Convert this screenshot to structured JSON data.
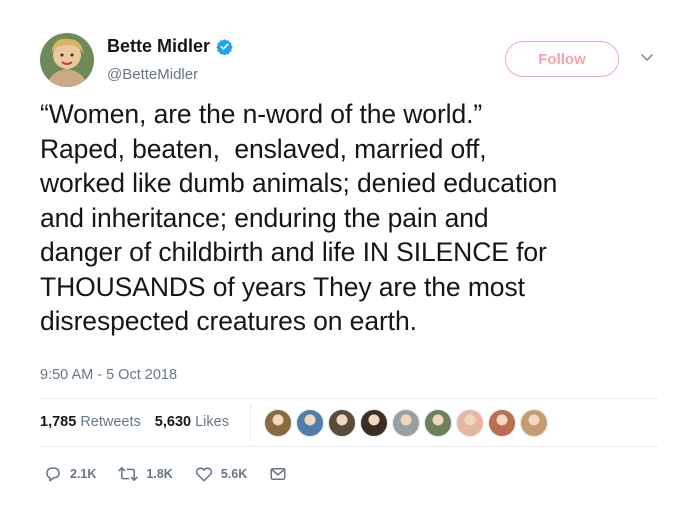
{
  "author": {
    "name": "Bette Midler",
    "handle": "@BetteMidler",
    "verified": true
  },
  "follow_label": "Follow",
  "tweet_lines": [
    "“Women, are the n-word of the world.”",
    "Raped, beaten,  enslaved, married off,",
    "worked like dumb animals; denied education",
    "and inheritance; enduring the pain and",
    "danger of childbirth and life IN SILENCE for",
    "THOUSANDS of years They are the most",
    "disrespected creatures on earth."
  ],
  "timestamp": "9:50 AM - 5 Oct 2018",
  "stats": {
    "retweets_count": "1,785",
    "retweets_label": "Retweets",
    "likes_count": "5,630",
    "likes_label": "Likes"
  },
  "liker_avatars": [
    {
      "color": "#8a6b3f"
    },
    {
      "color": "#4f7fa8"
    },
    {
      "color": "#5a4c3a"
    },
    {
      "color": "#3a2e25"
    },
    {
      "color": "#9aa0a0"
    },
    {
      "color": "#6d7f5c"
    },
    {
      "color": "#e7b7a3"
    },
    {
      "color": "#b96f50"
    },
    {
      "color": "#c79b70"
    }
  ],
  "actions": {
    "replies": "2.1K",
    "retweets": "1.8K",
    "likes": "5.6K"
  },
  "icons": [
    "verified-icon",
    "chevron-down-icon",
    "reply-icon",
    "retweet-icon",
    "like-icon",
    "message-icon"
  ],
  "colors": {
    "text": "#14171a",
    "secondary": "#657786",
    "verified": "#1da1f2",
    "follow_border": "#f3a9b1",
    "follow_text": "#f7a3ad"
  }
}
